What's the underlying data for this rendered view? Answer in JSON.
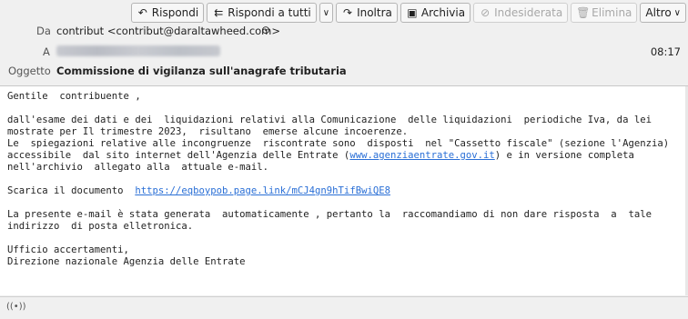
{
  "toolbar": {
    "reply": "Rispondi",
    "reply_all": "Rispondi a tutti",
    "forward": "Inoltra",
    "archive": "Archivia",
    "junk": "Indesiderata",
    "delete": "Elimina",
    "more": "Altro"
  },
  "header": {
    "from_label": "Da",
    "from_value": "contribut <contribut@daraltawheed.com>",
    "to_label": "A",
    "time": "08:17",
    "subject_label": "Oggetto",
    "subject_value": "Commissione di vigilanza sull'anagrafe tributaria"
  },
  "message": {
    "greeting": "Gentile  contribuente ,",
    "p1_l1": "dall'esame dei dati e dei  liquidazioni relativi alla Comunicazione  delle liquidazioni  periodiche Iva, da lei",
    "p1_l2": "mostrate per Il trimestre 2023,  risultano  emerse alcune incoerenze.",
    "p1_l3": "Le  spiegazioni relative alle incongruenze  riscontrate sono  disposti  nel \"Cassetto fiscale\" (sezione l'Agenzia)",
    "p1_l4_a": "accessibile  dal sito internet dell'Agenzia delle Entrate (",
    "p1_l4_link": "www.agenziaentrate.gov.it",
    "p1_l4_b": ") e in versione completa",
    "p1_l5": "nell'archivio  allegato alla  attuale e-mail.",
    "download_label": "Scarica il documento  ",
    "download_link": "https://eqboypob.page.link/mCJ4gn9hTifBwiQE8",
    "p3_l1": "La presente e-mail è stata generata  automaticamente , pertanto la  raccomandiamo di non dare risposta  a  tale",
    "p3_l2": "indirizzo  di posta elletronica.",
    "sign_l1": "Ufficio accertamenti,",
    "sign_l2": "Direzione nazionale Agenzia delle Entrate"
  },
  "icons": {
    "reply": "↶",
    "reply_all": "⇇",
    "forward": "↷",
    "archive": "▣",
    "junk": "⊘",
    "delete": "🗑",
    "chevron": "∨",
    "contact": "⊙",
    "status": "((•))"
  }
}
